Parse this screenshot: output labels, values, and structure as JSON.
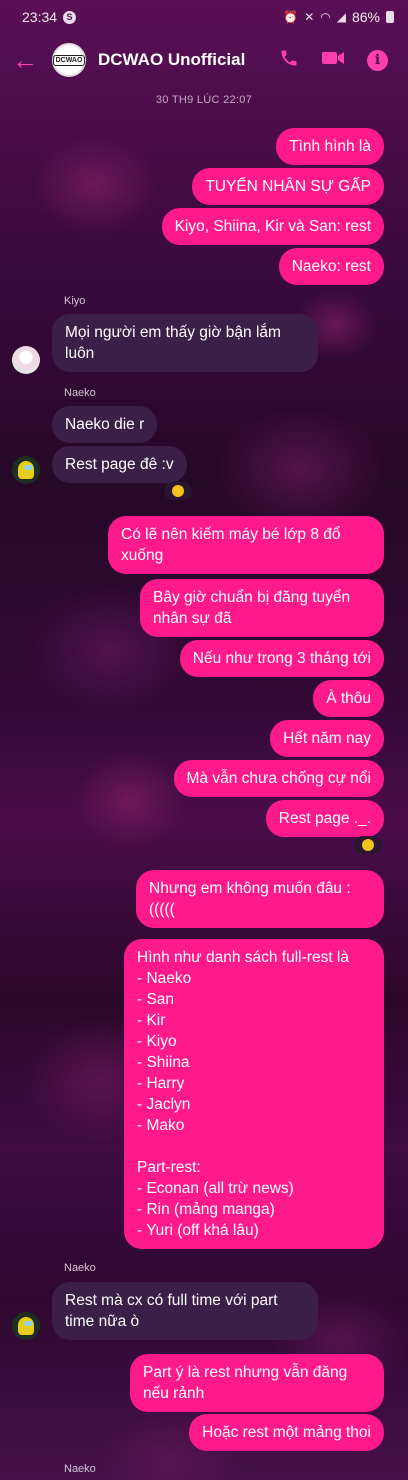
{
  "status_bar": {
    "time": "23:34",
    "notif_badge": "S",
    "battery": "86%"
  },
  "header": {
    "back_icon": "arrow-left-icon",
    "title": "DCWAO Unofficial",
    "avatar_text": "DCWAO"
  },
  "timestamp": "30 TH9 LÚC 22:07",
  "messages": {
    "m1": "Tình hình là",
    "m2": "TUYỂN NHÂN SỰ GẤP",
    "m3": "Kiyo, Shiina, Kir và San: rest",
    "m4": "Naeko: rest",
    "kiyo_name": "Kiyo",
    "m5": "Mọi người em thấy giờ bận lắm luôn",
    "naeko_name_1": "Naeko",
    "m6": "Naeko die r",
    "m7": "Rest page đê :v",
    "m8": "Có lẽ nên kiếm máy bé lớp 8 đổ xuống",
    "m9": "Bây giờ chuẩn bị đăng tuyển nhân sự đã",
    "m10": "Nếu như trong 3 tháng tới",
    "m11": "À thôu",
    "m12": "Hết năm nay",
    "m13": "Mà vẫn chưa chống cự nổi",
    "m14": "Rest page ._.",
    "m15": "Nhưng em không muốn đâu :((((( ",
    "m16": "Hình như danh sách full-rest là\n- Naeko\n- San\n- Kir\n- Kiyo\n- Shiina\n- Harry\n- Jaclyn\n- Mako\n\nPart-rest:\n- Econan (all trừ news)\n- Rin (mảng manga)\n- Yuri (off khá lâu)",
    "naeko_name_2": "Naeko",
    "m17": "Rest mà cx có full time với part time nữa ò",
    "m18": "Part ý là rest nhưng vẫn đăng nếu rảnh",
    "m19": "Hoặc rest một mảng thoi",
    "naeko_name_3": "Naeko"
  },
  "colors": {
    "accent": "#ff1a8c",
    "icon_pink": "#ff3fae",
    "incoming_bubble": "#3b1f47"
  }
}
